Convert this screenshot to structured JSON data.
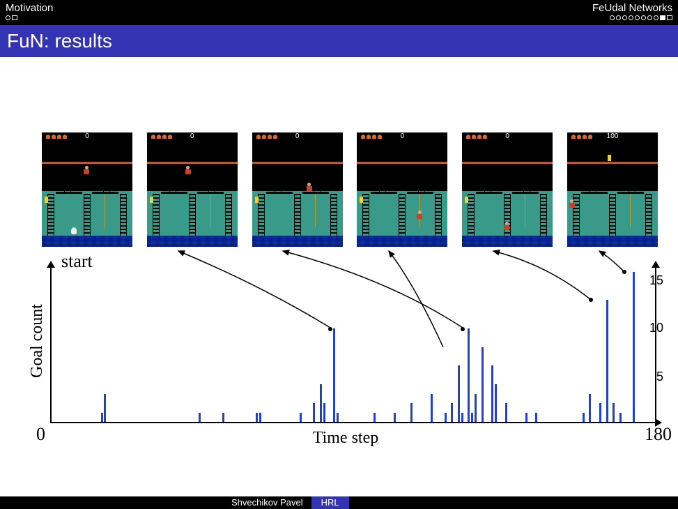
{
  "nav": {
    "left_section": "Motivation",
    "right_section": "FeUdal Networks",
    "left_progress": {
      "total": 2,
      "current": 0
    },
    "right_progress": {
      "total": 10,
      "current": 9
    }
  },
  "slide_title": "FuN: results",
  "figure": {
    "start_label": "start",
    "frames": [
      {
        "score": "0",
        "key_pos": "mid-left",
        "player_pos": "bottom",
        "skull": true
      },
      {
        "score": "0",
        "key_pos": "mid-left",
        "player_pos": "upper-mid",
        "skull": false
      },
      {
        "score": "0",
        "key_pos": "mid-left",
        "player_pos": "upper-mid",
        "skull": false
      },
      {
        "score": "0",
        "key_pos": "mid-left",
        "player_pos": "rope",
        "skull": false
      },
      {
        "score": "0",
        "key_pos": "mid-left",
        "player_pos": "lower-mid",
        "skull": false
      },
      {
        "score": "100",
        "key_pos": "upper-left",
        "player_pos": "mid-left",
        "skull": false
      }
    ]
  },
  "chart_data": {
    "type": "bar",
    "xlabel": "Time step",
    "ylabel": "Goal count",
    "xlim": [
      0,
      180
    ],
    "ylim": [
      0,
      16
    ],
    "xticks": [
      0,
      180
    ],
    "yticks": [
      5,
      10,
      15
    ],
    "x": [
      15,
      16,
      44,
      51,
      61,
      62,
      74,
      78,
      80,
      81,
      84,
      85,
      96,
      102,
      107,
      113,
      117,
      119,
      121,
      122,
      124,
      125,
      126,
      128,
      131,
      132,
      135,
      141,
      144,
      158,
      160,
      163,
      165,
      167,
      169,
      173
    ],
    "values": [
      1,
      3,
      1,
      1,
      1,
      1,
      1,
      2,
      4,
      2,
      10,
      1,
      1,
      1,
      2,
      3,
      1,
      2,
      6,
      1,
      10,
      1,
      3,
      8,
      6,
      4,
      2,
      1,
      1,
      1,
      3,
      2,
      13,
      2,
      1,
      16
    ],
    "annotated_peaks": [
      {
        "x": 84,
        "y": 10,
        "links_to_frame": 2
      },
      {
        "x": 124,
        "y": 10,
        "links_to_frame": 3
      },
      {
        "x": 162,
        "y": 13,
        "links_to_frame": 4
      },
      {
        "x": 173,
        "y": 16,
        "links_to_frame": 5
      }
    ],
    "note": "Curved arrows connect chart peaks to game frames 2–6 (1-indexed). Additional curve from frame 2 area points toward early region."
  },
  "footer": {
    "author": "Shvechikov Pavel",
    "topic": "HRL"
  }
}
